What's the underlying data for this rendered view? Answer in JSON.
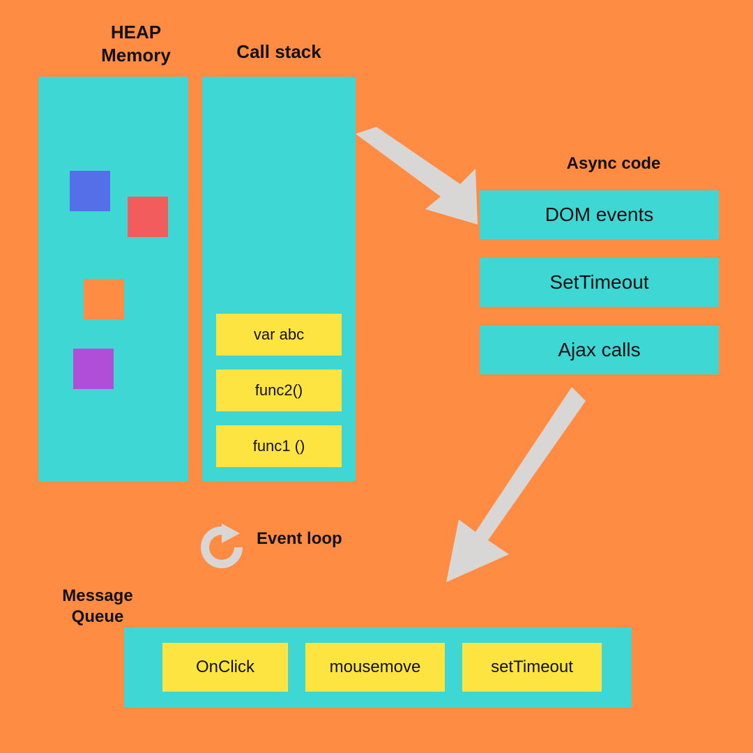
{
  "labels": {
    "heap": "HEAP\nMemory",
    "callstack": "Call stack",
    "async": "Async code",
    "eventloop": "Event loop",
    "msgqueue": "Message\nQueue"
  },
  "callstack_items": [
    "var abc",
    "func2()",
    "func1 ()"
  ],
  "async_items": [
    "DOM events",
    "SetTimeout",
    "Ajax calls"
  ],
  "queue_items": [
    "OnClick",
    "mousemove",
    "setTimeout"
  ],
  "heap_blocks": [
    {
      "color": "#556fe8"
    },
    {
      "color": "#f25c5c"
    },
    {
      "color": "#ff8c42"
    },
    {
      "color": "#b04ed8"
    }
  ],
  "colors": {
    "bg": "#ff8c42",
    "panel": "#3ed7d4",
    "card": "#fee440",
    "arrow": "#d9d6d6"
  }
}
